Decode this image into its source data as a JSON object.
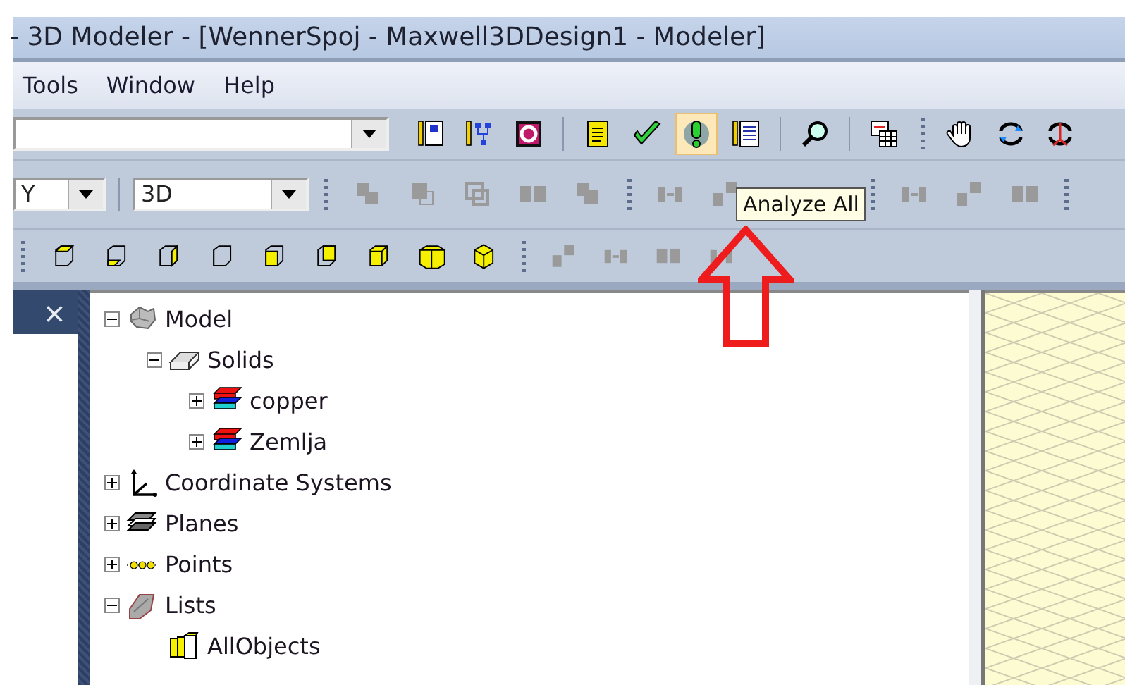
{
  "window": {
    "title": "- 3D Modeler - [WennerSpoj - Maxwell3DDesign1 - Modeler]"
  },
  "menu": [
    {
      "label": "Tools"
    },
    {
      "label": "Window"
    },
    {
      "label": "Help"
    }
  ],
  "toolbar_1": {
    "buttons": [
      {
        "kind": "notes",
        "hovered": false
      },
      {
        "kind": "hierarchy",
        "hovered": false
      },
      {
        "kind": "q",
        "hovered": false
      },
      {
        "kind": "sep"
      },
      {
        "kind": "report",
        "hovered": false
      },
      {
        "kind": "validate",
        "hovered": false
      },
      {
        "kind": "analyze",
        "hovered": true
      },
      {
        "kind": "doc",
        "hovered": false
      },
      {
        "kind": "sep"
      },
      {
        "kind": "zoom",
        "hovered": false
      },
      {
        "kind": "sep"
      },
      {
        "kind": "table",
        "hovered": false
      },
      {
        "kind": "grip"
      },
      {
        "kind": "pan",
        "hovered": false
      },
      {
        "kind": "rotate",
        "hovered": false
      },
      {
        "kind": "axes",
        "hovered": false
      }
    ]
  },
  "toolbar_2": {
    "plane_combo": {
      "value": "Y"
    },
    "view_combo": {
      "value": "3D"
    }
  },
  "tooltip": {
    "text": "Analyze All"
  },
  "side_panel": {
    "close": "×"
  },
  "tree": [
    {
      "label": "Model",
      "kind": "model",
      "expanded": true,
      "children": [
        {
          "label": "Solids",
          "kind": "solids",
          "expanded": true,
          "children": [
            {
              "label": "copper",
              "kind": "object",
              "expanded": false
            },
            {
              "label": "Zemlja",
              "kind": "object",
              "expanded": false
            }
          ]
        }
      ]
    },
    {
      "label": "Coordinate Systems",
      "kind": "coords",
      "expanded": false
    },
    {
      "label": "Planes",
      "kind": "planes",
      "expanded": false
    },
    {
      "label": "Points",
      "kind": "points",
      "expanded": false
    },
    {
      "label": "Lists",
      "kind": "lists",
      "expanded": true,
      "children": [
        {
          "label": "AllObjects",
          "kind": "allobjects"
        }
      ]
    }
  ]
}
